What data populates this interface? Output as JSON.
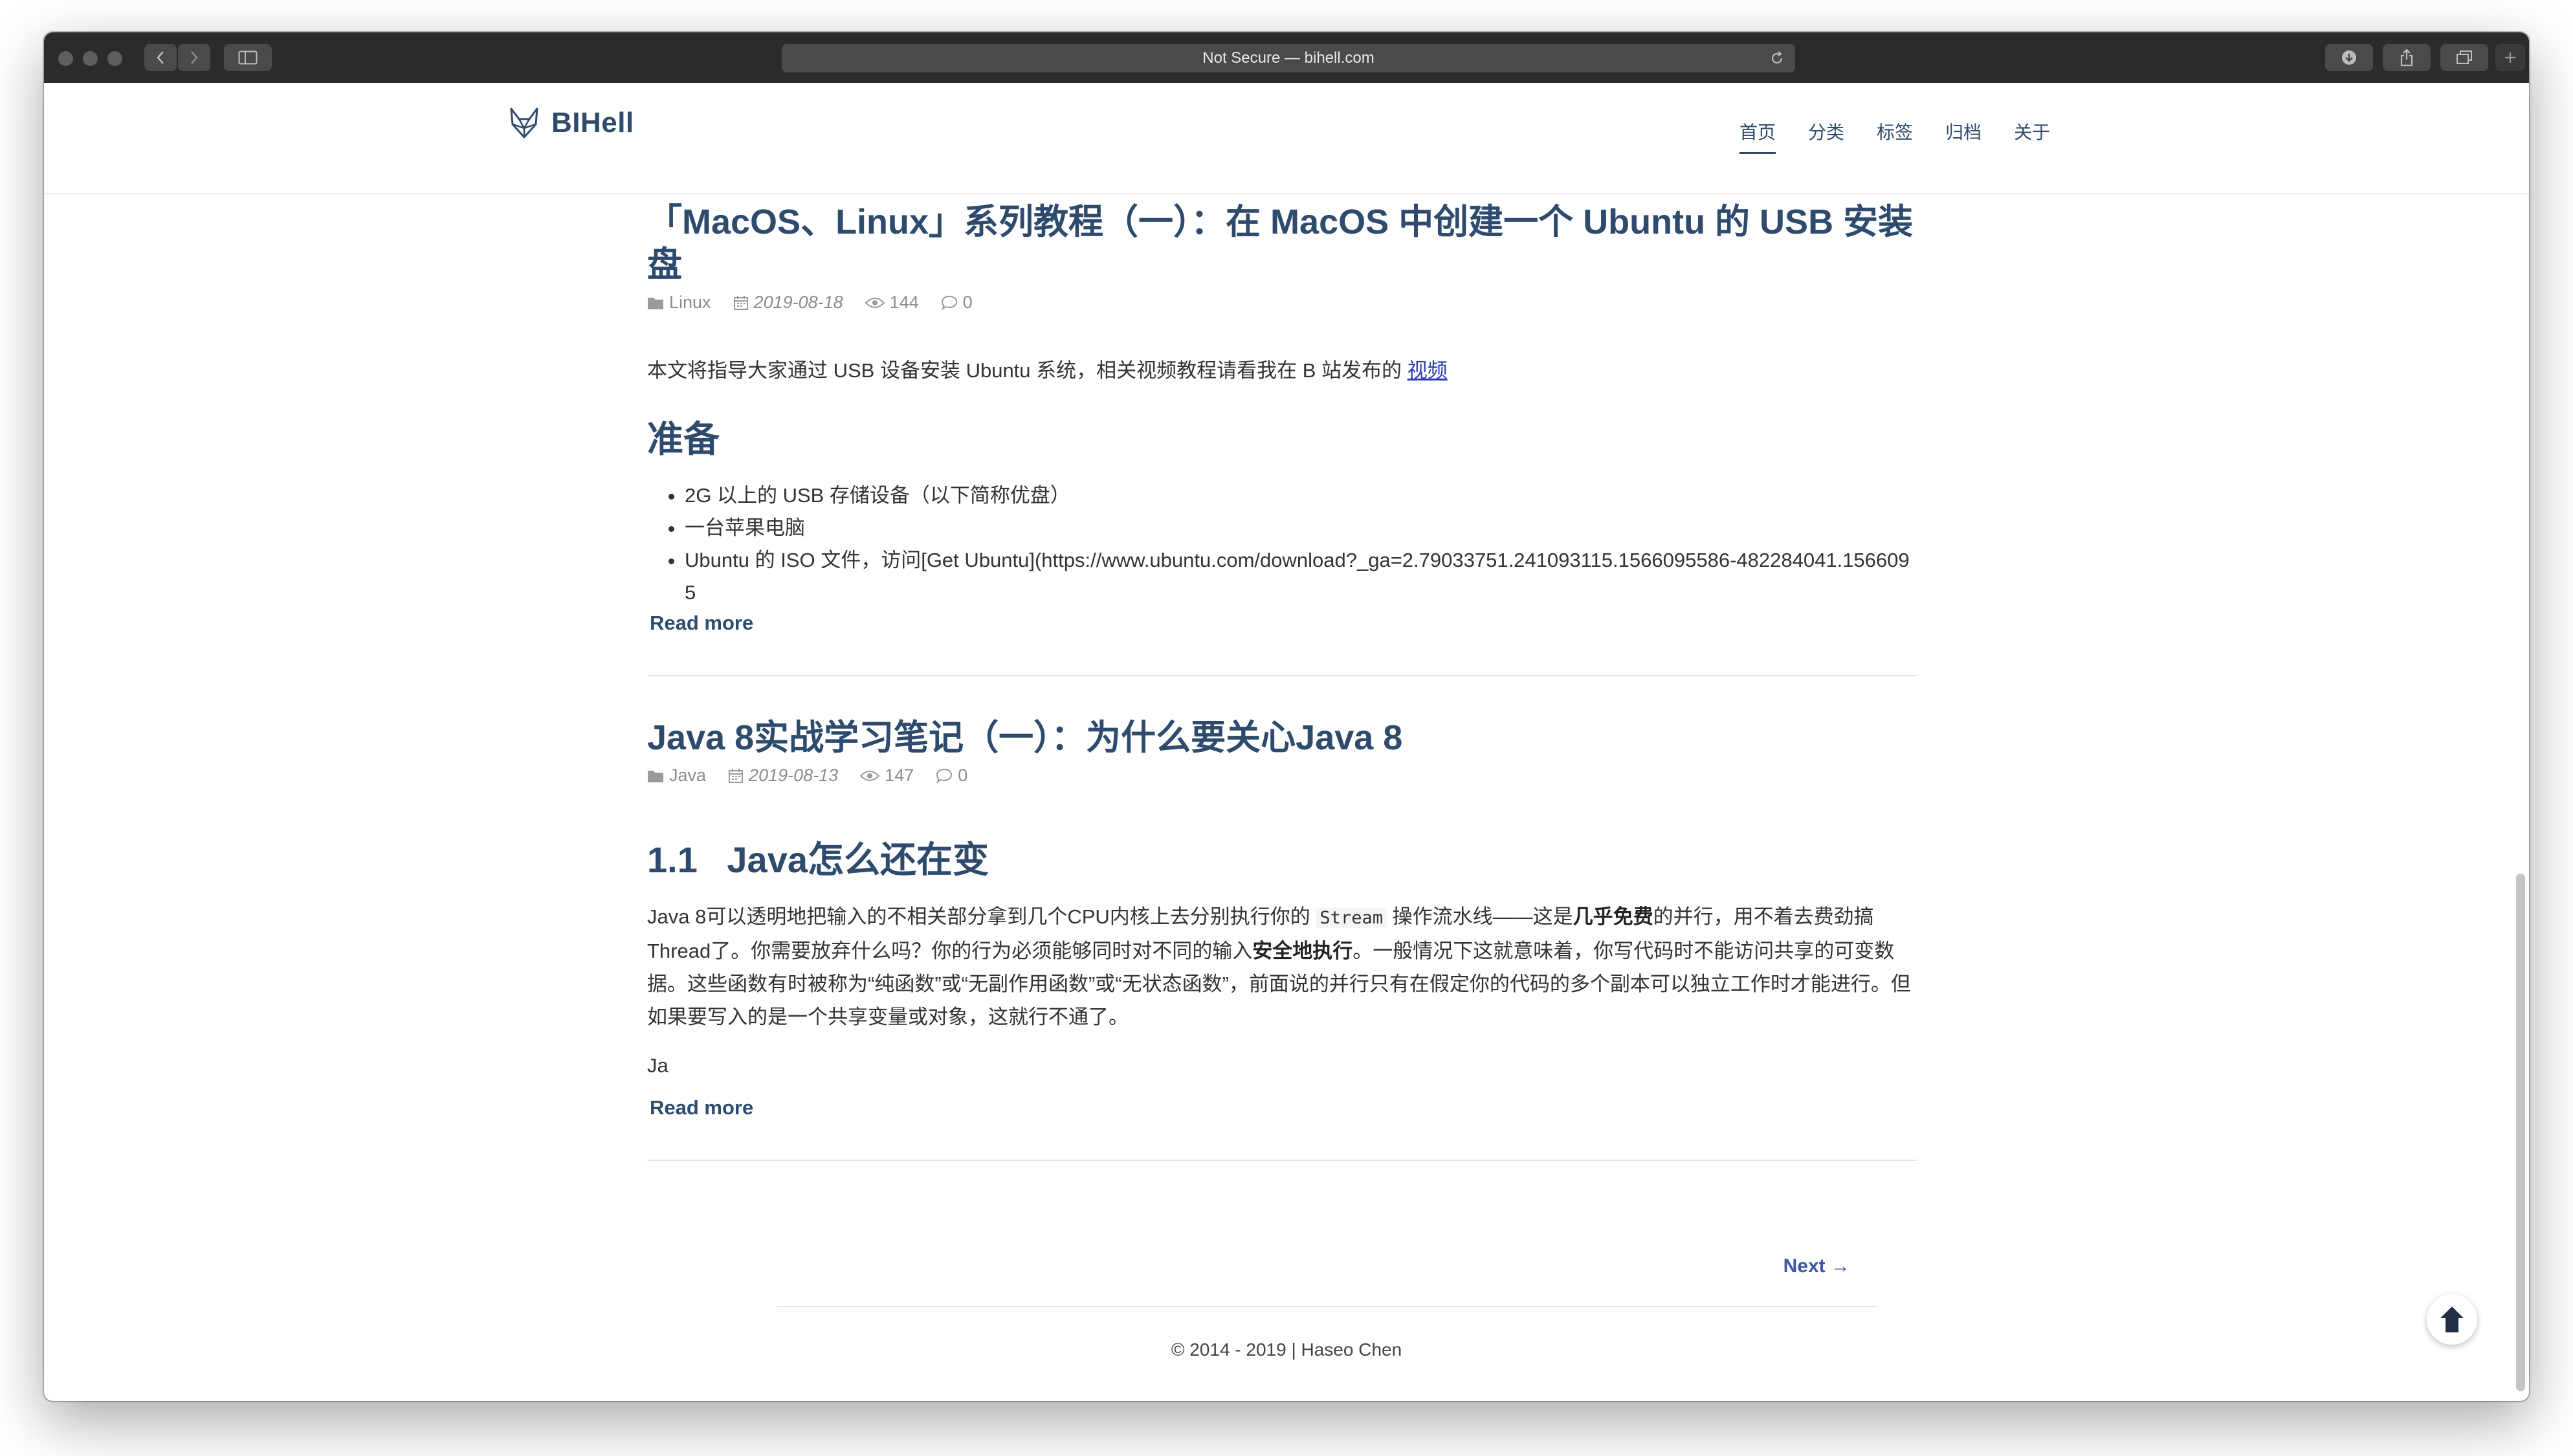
{
  "browser": {
    "address": "Not Secure — bihell.com"
  },
  "site": {
    "logo_text": "BIHell",
    "nav": [
      "首页",
      "分类",
      "标签",
      "归档",
      "关于"
    ]
  },
  "posts": [
    {
      "title": "「MacOS、Linux」系列教程（一）：在 MacOS 中创建一个 Ubuntu 的 USB 安装盘",
      "category": "Linux",
      "date": "2019-08-18",
      "views": "144",
      "comments": "0",
      "intro_text": "本文将指导大家通过 USB 设备安装 Ubuntu 系统，相关视频教程请看我在 B 站发布的",
      "intro_link": "视频",
      "section_heading": "准备",
      "list": [
        "2G 以上的 USB 存储设备（以下简称优盘）",
        "一台苹果电脑",
        "Ubuntu 的 ISO 文件，访问[Get Ubuntu](https://www.ubuntu.com/download?_ga=2.79033751.241093115.1566095586-482284041.1566095"
      ],
      "read_more": "Read more"
    },
    {
      "title": "Java 8实战学习笔记（一）：为什么要关心Java 8",
      "category": "Java",
      "date": "2019-08-13",
      "views": "147",
      "comments": "0",
      "section_heading": "1.1 Java怎么还在变",
      "para_parts": {
        "p1": "Java 8可以透明地把输入的不相关部分拿到几个CPU内核上去分别执行你的",
        "code": "Stream",
        "p2": "操作流水线——这是",
        "b1": "几乎免费",
        "p3": "的并行，用不着去费劲搞Thread了。你需要放弃什么吗？你的行为必须能够同时对不同的输入",
        "b2": "安全地执行",
        "p4": "。一般情况下这就意味着，你写代码时不能访问共享的可变数据。这些函数有时被称为“纯函数”或“无副作用函数”或“无状态函数”，前面说的并行只有在假定你的代码的多个副本可以独立工作时才能进行。但如果要写入的是一个共享变量或对象，这就行不通了。"
      },
      "tail": "Ja",
      "read_more": "Read more"
    }
  ],
  "pager": {
    "next": "Next →"
  },
  "footer": {
    "copyright": "© 2014 - 2019 | Haseo Chen"
  },
  "colors": {
    "brand": "#2e4b6d",
    "link": "#2a3bb7",
    "toolbar": "#2b2b2b"
  }
}
